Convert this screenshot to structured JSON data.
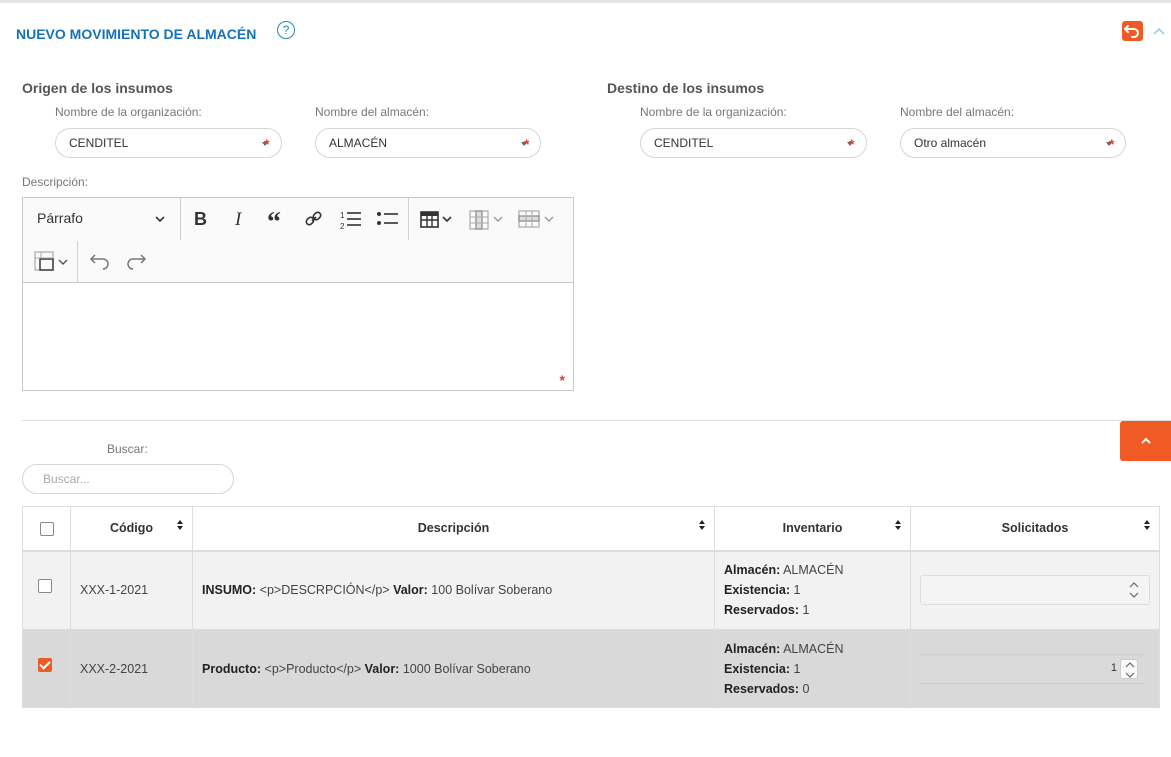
{
  "header": {
    "title": "NUEVO MOVIMIENTO DE ALMACÉN",
    "help_icon": "question-circle-icon",
    "back_icon": "undo-icon",
    "collapse_icon": "chevron-up-icon",
    "accent": "#f05a24",
    "title_color": "#1572b6"
  },
  "origin": {
    "title": "Origen de los insumos",
    "org_label": "Nombre de la organización:",
    "org_value": "CENDITEL",
    "warehouse_label": "Nombre del almacén:",
    "warehouse_value": "ALMACÉN"
  },
  "destination": {
    "title": "Destino de los insumos",
    "org_label": "Nombre de la organización:",
    "org_value": "CENDITEL",
    "warehouse_label": "Nombre del almacén:",
    "warehouse_value": "Otro almacén"
  },
  "required_mark": "*",
  "description": {
    "label": "Descripción:",
    "format_select": "Párrafo",
    "toolbar_icons": [
      "bold-icon",
      "italic-icon",
      "blockquote-icon",
      "link-icon",
      "numbered-list-icon",
      "bulleted-list-icon",
      "insert-table-icon",
      "table-column-icon",
      "table-row-icon",
      "merge-cells-icon",
      "undo-icon",
      "redo-icon"
    ]
  },
  "search": {
    "label": "Buscar:",
    "placeholder": "Buscar..."
  },
  "table": {
    "headers": {
      "code": "Código",
      "description": "Descripción",
      "inventory": "Inventario",
      "requested": "Solicitados"
    },
    "rows": [
      {
        "checked": false,
        "code": "XXX-1-2021",
        "desc_label": "INSUMO:",
        "desc_text": "<p>DESCRPCIÓN</p>",
        "value_label": "Valor:",
        "value_text": "100 Bolívar Soberano",
        "wh_label": "Almacén:",
        "wh_value": "ALMACÉN",
        "stock_label": "Existencia:",
        "stock_value": "1",
        "res_label": "Reservados:",
        "res_value": "1",
        "requested": ""
      },
      {
        "checked": true,
        "code": "XXX-2-2021",
        "desc_label": "Producto:",
        "desc_text": "<p>Producto</p>",
        "value_label": "Valor:",
        "value_text": "1000 Bolívar Soberano",
        "wh_label": "Almacén:",
        "wh_value": "ALMACÉN",
        "stock_label": "Existencia:",
        "stock_value": "1",
        "res_label": "Reservados:",
        "res_value": "0",
        "requested": "1"
      }
    ]
  }
}
